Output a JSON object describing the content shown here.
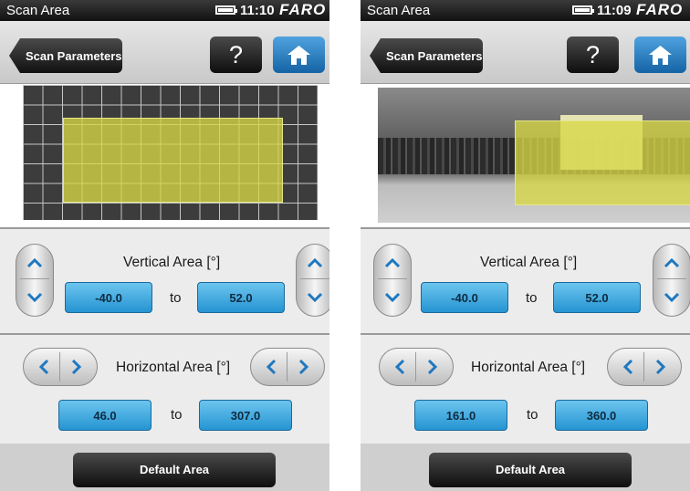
{
  "brand_color": "#1e78c0",
  "screens": [
    {
      "status": {
        "title": "Scan Area",
        "time": "11:10",
        "brand": "FARO",
        "battery_level": 0.9
      },
      "toolbar": {
        "back_label": "Scan Parameters",
        "help_label": "?",
        "home_icon": "home-icon"
      },
      "preview": {
        "type": "grid",
        "selection": {
          "h_start": 46.0,
          "h_end": 307.0,
          "v_start": -40.0,
          "v_end": 52.0
        }
      },
      "vertical": {
        "label": "Vertical Area [°]",
        "from": "-40.0",
        "to_label": "to",
        "to": "52.0"
      },
      "horizontal": {
        "label": "Horizontal Area [°]",
        "from": "46.0",
        "to_label": "to",
        "to": "307.0"
      },
      "default_button": "Default Area"
    },
    {
      "status": {
        "title": "Scan Area",
        "time": "11:09",
        "brand": "FARO",
        "battery_level": 0.9
      },
      "toolbar": {
        "back_label": "Scan Parameters",
        "help_label": "?",
        "home_icon": "home-icon"
      },
      "preview": {
        "type": "panorama",
        "selection": {
          "h_start": 161.0,
          "h_end": 360.0,
          "v_start": -40.0,
          "v_end": 52.0
        }
      },
      "vertical": {
        "label": "Vertical Area [°]",
        "from": "-40.0",
        "to_label": "to",
        "to": "52.0"
      },
      "horizontal": {
        "label": "Horizontal Area [°]",
        "from": "161.0",
        "to_label": "to",
        "to": "360.0"
      },
      "default_button": "Default Area"
    }
  ]
}
